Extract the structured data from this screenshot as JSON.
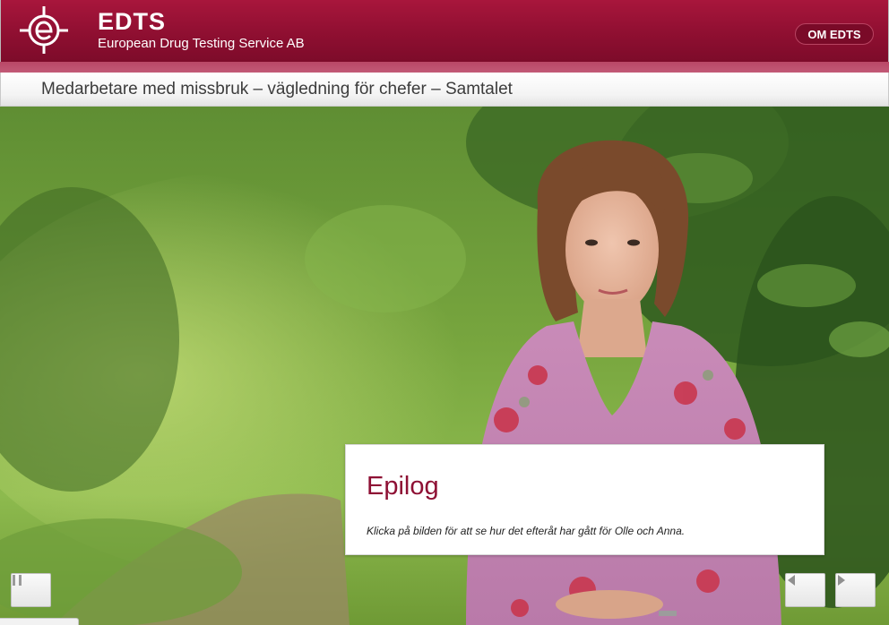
{
  "header": {
    "brand_name": "EDTS",
    "brand_subtitle": "European Drug Testing Service AB",
    "about_button": "OM EDTS",
    "logo_icon": "edts-e-crosshair-logo",
    "brand_color": "#8f0f31"
  },
  "course": {
    "title": "Medarbetare med missbruk – vägledning för chefer – Samtalet"
  },
  "scene": {
    "image": "woman-in-floral-blouse-forest-path"
  },
  "card": {
    "title": "Epilog",
    "text": "Klicka på bilden för att se hur det efteråt har gått för Olle och Anna.",
    "title_color": "#8e1034"
  },
  "controls": {
    "pause_icon": "pause-icon",
    "prev_icon": "arrow-left-icon",
    "next_icon": "arrow-right-icon"
  }
}
